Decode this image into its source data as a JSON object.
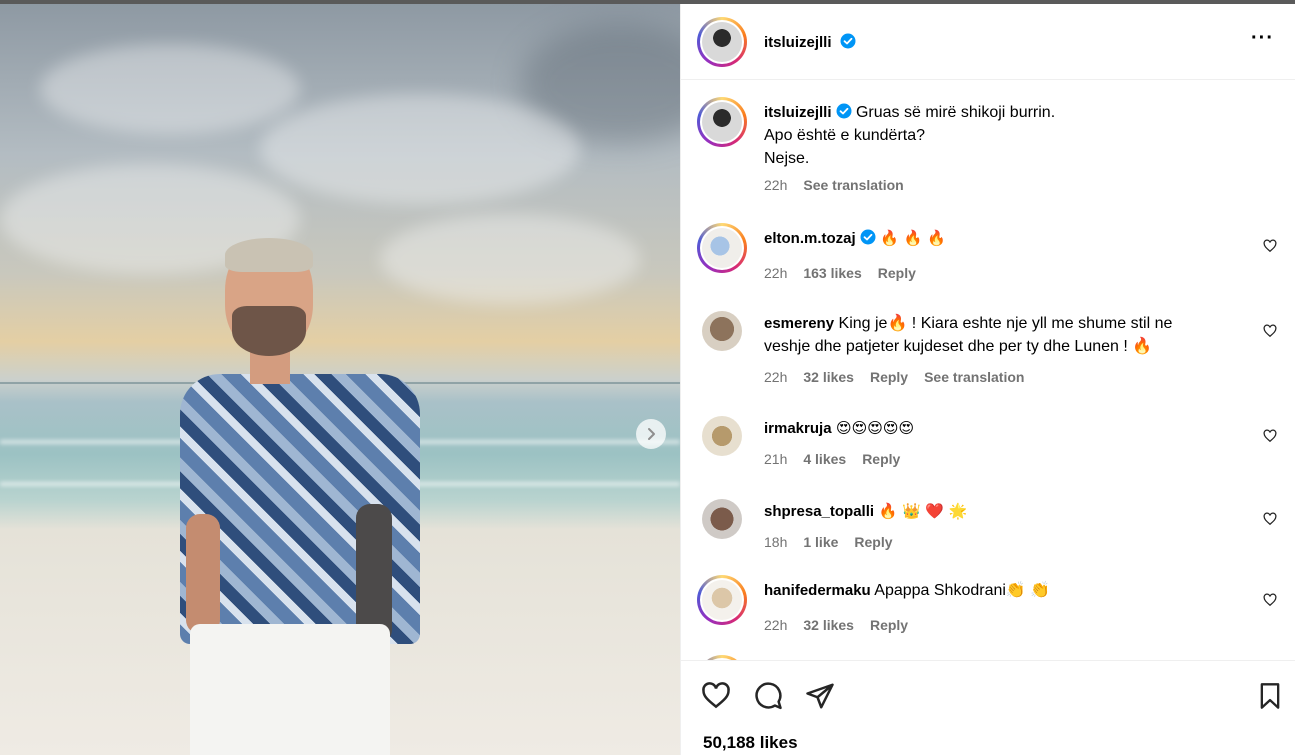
{
  "post": {
    "author": "itsluizejlli",
    "caption_lines": [
      "Gruas së mirë shikoji burrin.",
      "Apo është e kundërta?",
      "Nejse."
    ],
    "caption_time": "22h",
    "see_translation": "See translation",
    "likes": "50,188 likes"
  },
  "comments": [
    {
      "user": "elton.m.tozaj",
      "text": "🔥 🔥 🔥",
      "time": "22h",
      "likes": "163 likes",
      "reply": "Reply"
    },
    {
      "user": "esmereny",
      "text": "King je🔥 ! Kiara eshte nje yll me shume stil ne veshje dhe patjeter kujdeset dhe per ty dhe Lunen ! 🔥",
      "time": "22h",
      "likes": "32 likes",
      "reply": "Reply",
      "translation": "See translation"
    },
    {
      "user": "irmakruja",
      "text": "😍😍😍😍😍",
      "time": "21h",
      "likes": "4 likes",
      "reply": "Reply"
    },
    {
      "user": "shpresa_topalli",
      "text": "🔥 👑 ❤️ 🌟",
      "time": "18h",
      "likes": "1 like",
      "reply": "Reply"
    },
    {
      "user": "hanifedermaku",
      "text": "Apappa Shkodrani👏 👏",
      "time": "22h",
      "likes": "32 likes",
      "reply": "Reply"
    }
  ],
  "icons": {
    "verified": "verified-badge-icon",
    "more": "more-options-icon",
    "like": "heart-icon",
    "comment": "comment-icon",
    "share": "share-icon",
    "save": "bookmark-icon",
    "next": "chevron-right-icon"
  },
  "colors": {
    "verified": "#0095f6",
    "muted": "#737373"
  }
}
